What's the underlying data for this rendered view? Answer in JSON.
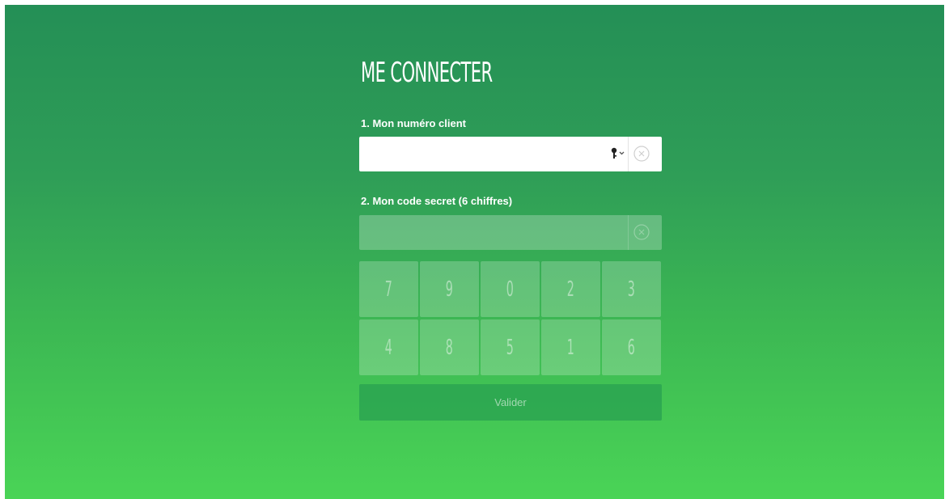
{
  "page": {
    "title": "ME CONNECTER"
  },
  "client_field": {
    "label": "1. Mon numéro client",
    "value": "",
    "placeholder": "",
    "key_icon": "key-icon",
    "clear_icon": "close-circle-icon"
  },
  "code_field": {
    "label": "2. Mon code secret (6 chiffres)",
    "value": "",
    "clear_icon": "close-circle-icon"
  },
  "keypad": {
    "rows": [
      [
        "7",
        "9",
        "0",
        "2",
        "3"
      ],
      [
        "4",
        "8",
        "5",
        "1",
        "6"
      ]
    ]
  },
  "submit": {
    "label": "Valider"
  },
  "colors": {
    "gradient_top": "#248f56",
    "gradient_bottom": "#4ad456",
    "text": "#ffffff"
  }
}
